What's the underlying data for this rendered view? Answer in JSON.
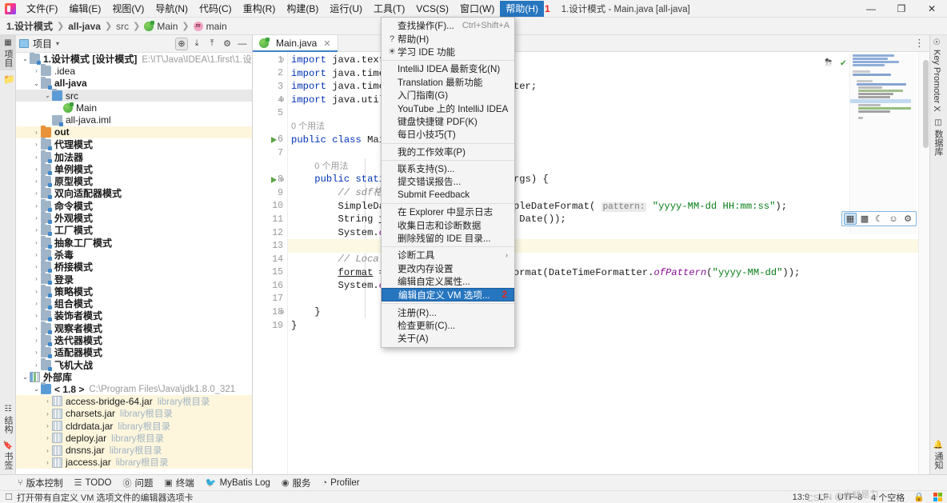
{
  "window": {
    "title": "1.设计模式 - Main.java [all-java]",
    "minimize": "—",
    "maximize": "❐",
    "close": "✕"
  },
  "menubar": {
    "items": [
      {
        "label": "文件(F)"
      },
      {
        "label": "编辑(E)"
      },
      {
        "label": "视图(V)"
      },
      {
        "label": "导航(N)"
      },
      {
        "label": "代码(C)"
      },
      {
        "label": "重构(R)"
      },
      {
        "label": "构建(B)"
      },
      {
        "label": "运行(U)"
      },
      {
        "label": "工具(T)"
      },
      {
        "label": "VCS(S)"
      },
      {
        "label": "窗口(W)"
      },
      {
        "label": "帮助(H)"
      }
    ],
    "active_label": "帮助(H)",
    "active_marker": "1"
  },
  "breadcrumb": {
    "items": [
      "1.设计模式",
      "all-java",
      "src",
      "Main",
      "main"
    ],
    "separator": "❯"
  },
  "toolbar": {
    "profile_icon": "user-profile-icon",
    "caret": "▾",
    "build_icon": "hammer-icon",
    "run_config": "Main",
    "run_icon": "run-icon",
    "debug_icon": "debug-icon",
    "run_coverage_icon": "run-with-coverage-icon",
    "profile_run_icon": "profiler-icon",
    "stop_icon": "stop-icon",
    "translate_icon": "translate-icon",
    "search_icon": "search-icon",
    "update_icon": "update-icon",
    "ide_icon": "ide-icon"
  },
  "left_strip": {
    "top": [
      {
        "label": "项目",
        "icon": "project-icon"
      }
    ],
    "bottom": [
      {
        "label": "书签",
        "icon": "bookmark-icon"
      },
      {
        "label": "结构",
        "icon": "structure-icon"
      }
    ]
  },
  "right_strip": {
    "top": [
      {
        "label": "Key Promoter X",
        "icon": "key-promoter-icon"
      },
      {
        "label": "数据库",
        "icon": "database-icon"
      }
    ],
    "bottom": [
      {
        "label": "通知",
        "icon": "bell-icon"
      }
    ]
  },
  "project_panel": {
    "title": "项目",
    "caret": "▾",
    "actions": [
      {
        "name": "locate-icon",
        "glyph": "⊕"
      },
      {
        "name": "expand-all-icon",
        "glyph": "⤓"
      },
      {
        "name": "collapse-all-icon",
        "glyph": "⤒"
      },
      {
        "name": "settings-icon",
        "glyph": "⚙"
      },
      {
        "name": "hide-icon",
        "glyph": "—"
      }
    ],
    "tree": [
      {
        "indent": 0,
        "twig": "⌄",
        "icon": "folder mod",
        "label": "1.设计模式 [设计模式]",
        "bold": true,
        "sub": "E:\\IT\\Java\\IDEA\\1.first\\1.设计模式",
        "state": ""
      },
      {
        "indent": 1,
        "twig": "›",
        "icon": "folder",
        "label": ".idea",
        "bold": false,
        "sub": "",
        "state": ""
      },
      {
        "indent": 1,
        "twig": "⌄",
        "icon": "folder mod",
        "label": "all-java",
        "bold": true,
        "sub": "",
        "state": ""
      },
      {
        "indent": 2,
        "twig": "⌄",
        "icon": "folder src",
        "label": "src",
        "bold": false,
        "sub": "",
        "state": "sel"
      },
      {
        "indent": 3,
        "twig": "",
        "icon": "cls",
        "label": "Main",
        "bold": false,
        "sub": "",
        "state": ""
      },
      {
        "indent": 2,
        "twig": "",
        "icon": "iml",
        "label": "all-java.iml",
        "bold": false,
        "sub": "",
        "state": ""
      },
      {
        "indent": 1,
        "twig": "›",
        "icon": "folder out",
        "label": "out",
        "bold": true,
        "sub": "",
        "state": "hl"
      },
      {
        "indent": 1,
        "twig": "›",
        "icon": "folder mod",
        "label": "代理模式",
        "bold": true,
        "sub": "",
        "state": ""
      },
      {
        "indent": 1,
        "twig": "›",
        "icon": "folder mod",
        "label": "加法器",
        "bold": true,
        "sub": "",
        "state": ""
      },
      {
        "indent": 1,
        "twig": "›",
        "icon": "folder mod",
        "label": "单例模式",
        "bold": true,
        "sub": "",
        "state": ""
      },
      {
        "indent": 1,
        "twig": "›",
        "icon": "folder mod",
        "label": "原型模式",
        "bold": true,
        "sub": "",
        "state": ""
      },
      {
        "indent": 1,
        "twig": "›",
        "icon": "folder mod",
        "label": "双向适配器模式",
        "bold": true,
        "sub": "",
        "state": ""
      },
      {
        "indent": 1,
        "twig": "›",
        "icon": "folder mod",
        "label": "命令模式",
        "bold": true,
        "sub": "",
        "state": ""
      },
      {
        "indent": 1,
        "twig": "›",
        "icon": "folder mod",
        "label": "外观模式",
        "bold": true,
        "sub": "",
        "state": ""
      },
      {
        "indent": 1,
        "twig": "›",
        "icon": "folder mod",
        "label": "工厂模式",
        "bold": true,
        "sub": "",
        "state": ""
      },
      {
        "indent": 1,
        "twig": "›",
        "icon": "folder mod",
        "label": "抽象工厂模式",
        "bold": true,
        "sub": "",
        "state": ""
      },
      {
        "indent": 1,
        "twig": "›",
        "icon": "folder mod",
        "label": "杀毒",
        "bold": true,
        "sub": "",
        "state": ""
      },
      {
        "indent": 1,
        "twig": "›",
        "icon": "folder mod",
        "label": "桥接模式",
        "bold": true,
        "sub": "",
        "state": ""
      },
      {
        "indent": 1,
        "twig": "›",
        "icon": "folder mod",
        "label": "登录",
        "bold": true,
        "sub": "",
        "state": ""
      },
      {
        "indent": 1,
        "twig": "›",
        "icon": "folder mod",
        "label": "策略模式",
        "bold": true,
        "sub": "",
        "state": ""
      },
      {
        "indent": 1,
        "twig": "›",
        "icon": "folder mod",
        "label": "组合模式",
        "bold": true,
        "sub": "",
        "state": ""
      },
      {
        "indent": 1,
        "twig": "›",
        "icon": "folder mod",
        "label": "装饰者模式",
        "bold": true,
        "sub": "",
        "state": ""
      },
      {
        "indent": 1,
        "twig": "›",
        "icon": "folder mod",
        "label": "观察者模式",
        "bold": true,
        "sub": "",
        "state": ""
      },
      {
        "indent": 1,
        "twig": "›",
        "icon": "folder mod",
        "label": "迭代器模式",
        "bold": true,
        "sub": "",
        "state": ""
      },
      {
        "indent": 1,
        "twig": "›",
        "icon": "folder mod",
        "label": "适配器模式",
        "bold": true,
        "sub": "",
        "state": ""
      },
      {
        "indent": 1,
        "twig": "›",
        "icon": "folder mod",
        "label": "飞机大战",
        "bold": true,
        "sub": "",
        "state": ""
      },
      {
        "indent": 0,
        "twig": "⌄",
        "icon": "extlib",
        "label": "外部库",
        "bold": true,
        "sub": "",
        "state": ""
      },
      {
        "indent": 1,
        "twig": "⌄",
        "icon": "folder src",
        "label": "< 1.8 >",
        "bold": true,
        "sub": "C:\\Program Files\\Java\\jdk1.8.0_321",
        "state": ""
      },
      {
        "indent": 2,
        "twig": "›",
        "icon": "lib",
        "label": "access-bridge-64.jar",
        "bold": false,
        "sub": "library根目录",
        "state": "hl"
      },
      {
        "indent": 2,
        "twig": "›",
        "icon": "lib",
        "label": "charsets.jar",
        "bold": false,
        "sub": "library根目录",
        "state": "hl"
      },
      {
        "indent": 2,
        "twig": "›",
        "icon": "lib",
        "label": "cldrdata.jar",
        "bold": false,
        "sub": "library根目录",
        "state": "hl"
      },
      {
        "indent": 2,
        "twig": "›",
        "icon": "lib",
        "label": "deploy.jar",
        "bold": false,
        "sub": "library根目录",
        "state": "hl"
      },
      {
        "indent": 2,
        "twig": "›",
        "icon": "lib",
        "label": "dnsns.jar",
        "bold": false,
        "sub": "library根目录",
        "state": "hl"
      },
      {
        "indent": 2,
        "twig": "›",
        "icon": "lib",
        "label": "jaccess.jar",
        "bold": false,
        "sub": "library根目录",
        "state": "hl"
      }
    ]
  },
  "editor": {
    "tab": {
      "label": "Main.java",
      "close": "✕",
      "icon": "java-class-icon"
    },
    "settings_icon": "⋮",
    "inspect": {
      "eye_icon": "inspection-off-icon",
      "check_icon": "✔"
    },
    "lines": [
      {
        "n": "1",
        "run": false,
        "fold": "⊖",
        "caret": false
      },
      {
        "n": "2",
        "run": false,
        "fold": "",
        "caret": false
      },
      {
        "n": "3",
        "run": false,
        "fold": "",
        "caret": false
      },
      {
        "n": "4",
        "run": false,
        "fold": "⊖",
        "caret": false
      },
      {
        "n": "5",
        "run": false,
        "fold": "",
        "caret": false
      },
      {
        "n": "",
        "run": false,
        "fold": "",
        "caret": false
      },
      {
        "n": "6",
        "run": true,
        "fold": "",
        "caret": false
      },
      {
        "n": "7",
        "run": false,
        "fold": "",
        "caret": false
      },
      {
        "n": "",
        "run": false,
        "fold": "",
        "caret": false
      },
      {
        "n": "8",
        "run": true,
        "fold": "⊖",
        "caret": false
      },
      {
        "n": "9",
        "run": false,
        "fold": "",
        "caret": false
      },
      {
        "n": "10",
        "run": false,
        "fold": "",
        "caret": false
      },
      {
        "n": "11",
        "run": false,
        "fold": "",
        "caret": false
      },
      {
        "n": "12",
        "run": false,
        "fold": "",
        "caret": false
      },
      {
        "n": "13",
        "run": false,
        "fold": "",
        "caret": true
      },
      {
        "n": "14",
        "run": false,
        "fold": "",
        "caret": false
      },
      {
        "n": "15",
        "run": false,
        "fold": "",
        "caret": false
      },
      {
        "n": "16",
        "run": false,
        "fold": "",
        "caret": false
      },
      {
        "n": "17",
        "run": false,
        "fold": "",
        "caret": false
      },
      {
        "n": "18",
        "run": false,
        "fold": "⊖",
        "caret": false
      },
      {
        "n": "19",
        "run": false,
        "fold": "",
        "caret": false
      }
    ],
    "code": {
      "l1": "import java.text.SimpleDateFormat;",
      "l2": "import java.time.LocalDateTime;",
      "l3": "import java.time.format.DateTimeFormatter;",
      "l4": "import java.util.Date;",
      "usage_class": "0 个用法",
      "l6": "public class Main {",
      "usage_method": "0 个用法",
      "l8": "public static void main(String[] args) {",
      "l9": "// sdf格式化",
      "l10_a": "SimpleDateFormat sdf = new SimpleDateFormat(",
      "l10_hint": "pattern:",
      "l10_str": "\"yyyy-MM-dd HH:mm:ss\"",
      "l10_b": ");",
      "l11": "String format = sdf.format(new Date());",
      "l12": "System.out.println(format);",
      "l14": "// LocalDateTime格式化",
      "l15_a": "format = LocalDateTime.now().format(DateTimeFormatter.",
      "l15_b": "ofPattern",
      "l15_str": "\"yyyy-MM-dd\"",
      "l15_c": "));",
      "l16": "System.out.println(format);",
      "l18": "}",
      "l19": "}"
    }
  },
  "help_menu": {
    "items": [
      {
        "label": "查找操作(F)...",
        "icon": "",
        "shortcut": "Ctrl+Shift+A",
        "arrow": "",
        "selected": false,
        "marker": "",
        "sep_after": false
      },
      {
        "label": "帮助(H)",
        "icon": "?",
        "shortcut": "",
        "arrow": "",
        "selected": false,
        "marker": "",
        "sep_after": false
      },
      {
        "label": "学习 IDE 功能",
        "icon": "☀",
        "shortcut": "",
        "arrow": "",
        "selected": false,
        "marker": "",
        "sep_after": true
      },
      {
        "label": "IntelliJ IDEA 最新变化(N)",
        "icon": "",
        "shortcut": "",
        "arrow": "",
        "selected": false,
        "marker": "",
        "sep_after": false
      },
      {
        "label": "Translation 最新功能",
        "icon": "",
        "shortcut": "",
        "arrow": "",
        "selected": false,
        "marker": "",
        "sep_after": false
      },
      {
        "label": "入门指南(G)",
        "icon": "",
        "shortcut": "",
        "arrow": "",
        "selected": false,
        "marker": "",
        "sep_after": false
      },
      {
        "label": "YouTube 上的 IntelliJ IDEA",
        "icon": "",
        "shortcut": "",
        "arrow": "",
        "selected": false,
        "marker": "",
        "sep_after": false
      },
      {
        "label": "键盘快捷键 PDF(K)",
        "icon": "",
        "shortcut": "",
        "arrow": "",
        "selected": false,
        "marker": "",
        "sep_after": false
      },
      {
        "label": "每日小技巧(T)",
        "icon": "",
        "shortcut": "",
        "arrow": "",
        "selected": false,
        "marker": "",
        "sep_after": true
      },
      {
        "label": "我的工作效率(P)",
        "icon": "",
        "shortcut": "",
        "arrow": "",
        "selected": false,
        "marker": "",
        "sep_after": true
      },
      {
        "label": "联系支持(S)...",
        "icon": "",
        "shortcut": "",
        "arrow": "",
        "selected": false,
        "marker": "",
        "sep_after": false
      },
      {
        "label": "提交错误报告...",
        "icon": "",
        "shortcut": "",
        "arrow": "",
        "selected": false,
        "marker": "",
        "sep_after": false
      },
      {
        "label": "Submit Feedback",
        "icon": "",
        "shortcut": "",
        "arrow": "",
        "selected": false,
        "marker": "",
        "sep_after": true
      },
      {
        "label": "在 Explorer 中显示日志",
        "icon": "",
        "shortcut": "",
        "arrow": "",
        "selected": false,
        "marker": "",
        "sep_after": false
      },
      {
        "label": "收集日志和诊断数据",
        "icon": "",
        "shortcut": "",
        "arrow": "",
        "selected": false,
        "marker": "",
        "sep_after": false
      },
      {
        "label": "删除残留的 IDE 目录...",
        "icon": "",
        "shortcut": "",
        "arrow": "",
        "selected": false,
        "marker": "",
        "sep_after": true
      },
      {
        "label": "诊断工具",
        "icon": "",
        "shortcut": "",
        "arrow": "›",
        "selected": false,
        "marker": "",
        "sep_after": false
      },
      {
        "label": "更改内存设置",
        "icon": "",
        "shortcut": "",
        "arrow": "",
        "selected": false,
        "marker": "",
        "sep_after": false
      },
      {
        "label": "编辑自定义属性...",
        "icon": "",
        "shortcut": "",
        "arrow": "",
        "selected": false,
        "marker": "",
        "sep_after": false
      },
      {
        "label": "编辑自定义 VM 选项...",
        "icon": "",
        "shortcut": "",
        "arrow": "",
        "selected": true,
        "marker": "2",
        "sep_after": true
      },
      {
        "label": "注册(R)...",
        "icon": "",
        "shortcut": "",
        "arrow": "",
        "selected": false,
        "marker": "",
        "sep_after": false
      },
      {
        "label": "检查更新(C)...",
        "icon": "",
        "shortcut": "",
        "arrow": "",
        "selected": false,
        "marker": "",
        "sep_after": false
      },
      {
        "label": "关于(A)",
        "icon": "",
        "shortcut": "",
        "arrow": "",
        "selected": false,
        "marker": "",
        "sep_after": false
      }
    ]
  },
  "float_toolbar": {
    "items": [
      {
        "name": "grid-view-icon",
        "glyph": "▦",
        "selected": true
      },
      {
        "name": "zen-mode-icon",
        "glyph": "▩",
        "selected": false
      },
      {
        "name": "dark-mode-icon",
        "glyph": "☾",
        "selected": false
      },
      {
        "name": "accessibility-icon",
        "glyph": "☺",
        "selected": false
      },
      {
        "name": "settings-icon",
        "glyph": "⚙",
        "selected": false
      }
    ]
  },
  "bottom_bar": {
    "items": [
      {
        "label": "版本控制",
        "icon": "branch-icon",
        "glyph": "⑂"
      },
      {
        "label": "TODO",
        "icon": "todo-icon",
        "glyph": "☰"
      },
      {
        "label": "问题",
        "icon": "problems-icon",
        "glyph": "⓪"
      },
      {
        "label": "终端",
        "icon": "terminal-icon",
        "glyph": "▣"
      },
      {
        "label": "MyBatis Log",
        "icon": "mybatis-icon",
        "glyph": "🐦"
      },
      {
        "label": "服务",
        "icon": "services-icon",
        "glyph": "◉"
      },
      {
        "label": "Profiler",
        "icon": "profiler-icon",
        "glyph": "◔"
      }
    ]
  },
  "status_bar": {
    "message": "打开带有自定义 VM 选项文件的编辑器选项卡",
    "message_icon": "note-icon",
    "caret_position": "13:9",
    "line_separator": "LF",
    "encoding": "UTF-8",
    "indent": "4 个空格",
    "lock_icon": "🔒",
    "os_icon": "windows-logo-icon",
    "watermark": "CSDN @你就是力"
  }
}
